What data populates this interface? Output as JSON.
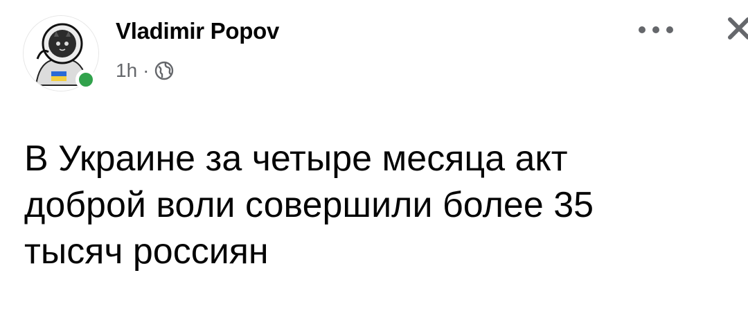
{
  "post": {
    "author": {
      "name": "Vladimir Popov",
      "online": true
    },
    "meta": {
      "time": "1h",
      "separator": "·",
      "audience_icon": "globe-icon"
    },
    "header_icons": {
      "more": "more-horizontal-icon",
      "close": "close-icon"
    },
    "text": "В Украине за четыре месяца  акт\nдоброй воли совершили более 35\nтысяч россиян",
    "colors": {
      "online": "#31a24c",
      "secondary_text": "#65676b",
      "primary_text": "#050505"
    }
  }
}
